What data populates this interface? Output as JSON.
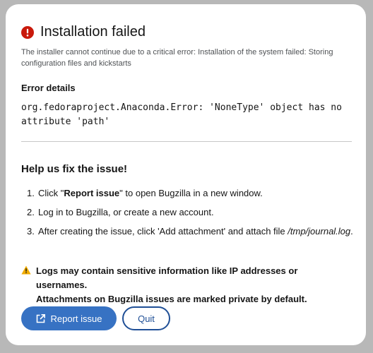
{
  "dialog": {
    "title": "Installation failed",
    "description": "The installer cannot continue due to a critical error: Installation of the system failed: Storing configuration files and kickstarts",
    "details_heading": "Error details",
    "details_line1": "org.fedoraproject.Anaconda.Error: 'NoneType' object has no",
    "details_line2": "attribute 'path'"
  },
  "help": {
    "heading": "Help us fix the issue!",
    "steps": [
      {
        "num": "1.",
        "pre": "Click \"",
        "bold": "Report issue",
        "post": "\" to open Bugzilla in a new window."
      },
      {
        "num": "2.",
        "text": "Log in to Bugzilla, or create a new account."
      },
      {
        "num": "3.",
        "pre": "After creating the issue, click 'Add attachment' and attach file ",
        "italic": "/tmp/journal.log",
        "post": "."
      }
    ]
  },
  "warning": {
    "line1": "Logs may contain sensitive information like IP addresses or usernames.",
    "line2": "Attachments on Bugzilla issues are marked private by default."
  },
  "actions": {
    "report_label": "Report issue",
    "quit_label": "Quit"
  },
  "icons": {
    "error": "error-circle-icon",
    "warning": "warning-triangle-icon",
    "external": "external-link-icon"
  },
  "colors": {
    "error": "#c9190b",
    "warning": "#f0ab00",
    "primary": "#3772c3",
    "secondary_border": "#1f4f96"
  }
}
